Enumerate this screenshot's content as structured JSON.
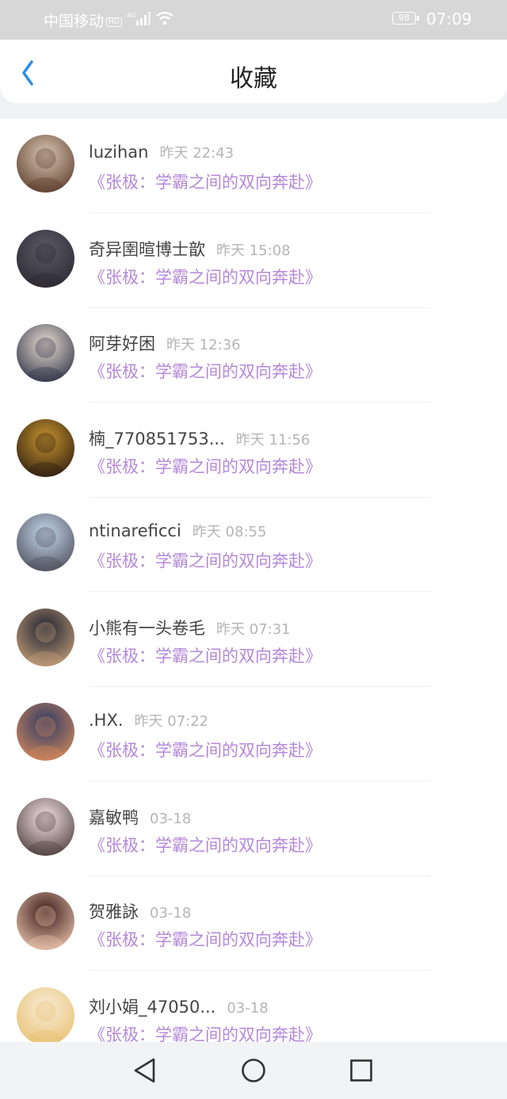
{
  "status_bar": {
    "carrier": "中国移动",
    "hd": "HD",
    "battery": "98",
    "time": "07:09"
  },
  "header": {
    "title": "收藏"
  },
  "items": [
    {
      "name": "luzihan",
      "time": "昨天 22:43",
      "novel": "《张极：学霸之间的双向奔赴》",
      "avatar_colors": [
        "#d9c7b3",
        "#5a3a28"
      ]
    },
    {
      "name": "奇异圉暄博士歆",
      "time": "昨天 15:08",
      "novel": "《张极：学霸之间的双向奔赴》",
      "avatar_colors": [
        "#5c5a66",
        "#2a2830"
      ]
    },
    {
      "name": "阿芽好困",
      "time": "昨天 12:36",
      "novel": "《张极：学霸之间的双向奔赴》",
      "avatar_colors": [
        "#e8dcd0",
        "#2b2f45"
      ]
    },
    {
      "name": "楠_770851753...",
      "time": "昨天 11:56",
      "novel": "《张极：学霸之间的双向奔赴》",
      "avatar_colors": [
        "#c8952e",
        "#2a1a10"
      ]
    },
    {
      "name": "ntinareficci",
      "time": "昨天 08:55",
      "novel": "《张极：学霸之间的双向奔赴》",
      "avatar_colors": [
        "#c6d9f0",
        "#4a4a55"
      ]
    },
    {
      "name": "小熊有一头卷毛",
      "time": "昨天 07:31",
      "novel": "《张极：学霸之间的双向奔赴》",
      "avatar_colors": [
        "#1e2232",
        "#c9a27a"
      ]
    },
    {
      "name": ".HX.",
      "time": "昨天 07:22",
      "novel": "《张极：学霸之间的双向奔赴》",
      "avatar_colors": [
        "#2c3b66",
        "#d98a5a"
      ]
    },
    {
      "name": "嘉敏鸭",
      "time": "03-18",
      "novel": "《张极：学霸之间的双向奔赴》",
      "avatar_colors": [
        "#f3e3e6",
        "#4a3a38"
      ]
    },
    {
      "name": "贺雅詠",
      "time": "03-18",
      "novel": "《张极：学霸之间的双向奔赴》",
      "avatar_colors": [
        "#3a1a1a",
        "#f0c8b0"
      ]
    },
    {
      "name": "刘小娟_47050...",
      "time": "03-18",
      "novel": "《张极：学霸之间的双向奔赴》",
      "avatar_colors": [
        "#f8ecd8",
        "#e8c070"
      ]
    }
  ],
  "nav": {
    "back_icon": "back-triangle-icon",
    "home_icon": "home-circle-icon",
    "recent_icon": "recent-square-icon"
  },
  "colors": {
    "accent_blue": "#2a8ce6",
    "novel_purple": "#b488d9",
    "status_bar_bg": "#d7d7d7"
  }
}
